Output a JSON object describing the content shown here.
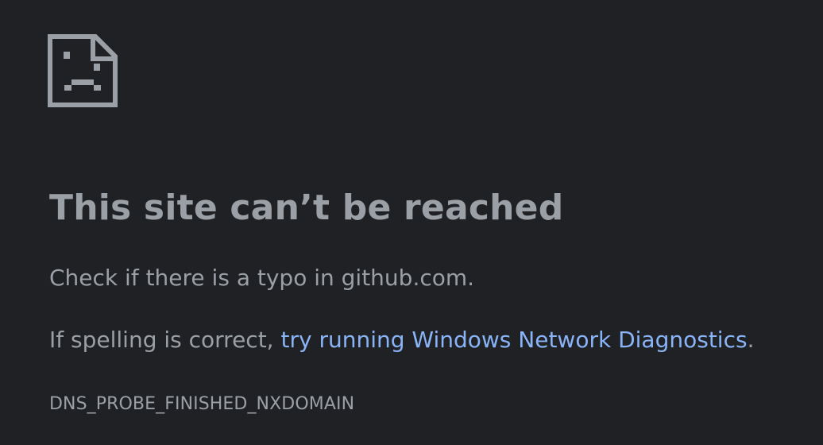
{
  "error": {
    "icon": "sad-page-icon",
    "title": "This site can’t be reached",
    "message": "Check if there is a typo in github.com.",
    "suggestion_prefix": "If spelling is correct, ",
    "suggestion_link": "try running Windows Network Diagnostics",
    "suggestion_suffix": ".",
    "code": "DNS_PROBE_FINISHED_NXDOMAIN"
  },
  "colors": {
    "background": "#202124",
    "text": "#9aa0a6",
    "link": "#8ab4f8"
  }
}
